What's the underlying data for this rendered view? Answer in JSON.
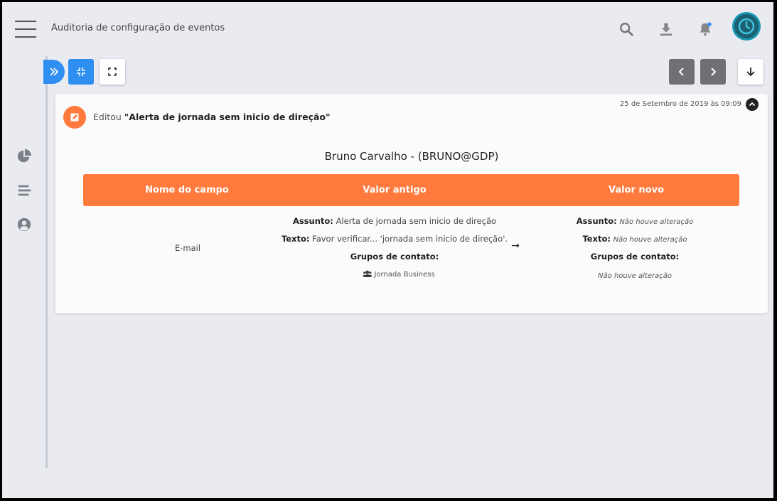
{
  "header": {
    "title": "Auditoria de configuração de eventos",
    "icons": [
      "search-icon",
      "download-icon",
      "bell-icon"
    ],
    "notification_dot_color": "#2f8ff0"
  },
  "sidebar": {
    "items": [
      "pie-chart-icon",
      "list-icon",
      "user-circle-icon"
    ]
  },
  "toolbar": {
    "buttons": [
      "expand-panel",
      "compress",
      "fullscreen",
      "previous",
      "next",
      "scroll-down"
    ]
  },
  "event": {
    "action_prefix": "Editou",
    "action_target": "\"Alerta de jornada sem inicio de direção\"",
    "timestamp": "25 de Setembro de 2019 às 09:09",
    "user": "Bruno Carvalho - (BRUNO@GDP)",
    "accent_color": "#ff7a3c",
    "table": {
      "headers": {
        "field": "Nome do campo",
        "old": "Valor antigo",
        "new": "Valor novo"
      },
      "row": {
        "field": "E-mail",
        "old": {
          "subject_label": "Assunto:",
          "subject_value": "Alerta de jornada sem inicio de direção",
          "text_label": "Texto:",
          "text_value": "Favor verificar... 'jornada sem inicio de direção'.",
          "groups_label": "Grupos de contato:",
          "group_name": "Jornada Business"
        },
        "arrow": "→",
        "new": {
          "subject_label": "Assunto:",
          "subject_value": "Não houve alteração",
          "text_label": "Texto:",
          "text_value": "Não houve alteração",
          "groups_label": "Grupos de contato:",
          "groups_value": "Não houve alteração"
        }
      }
    }
  }
}
